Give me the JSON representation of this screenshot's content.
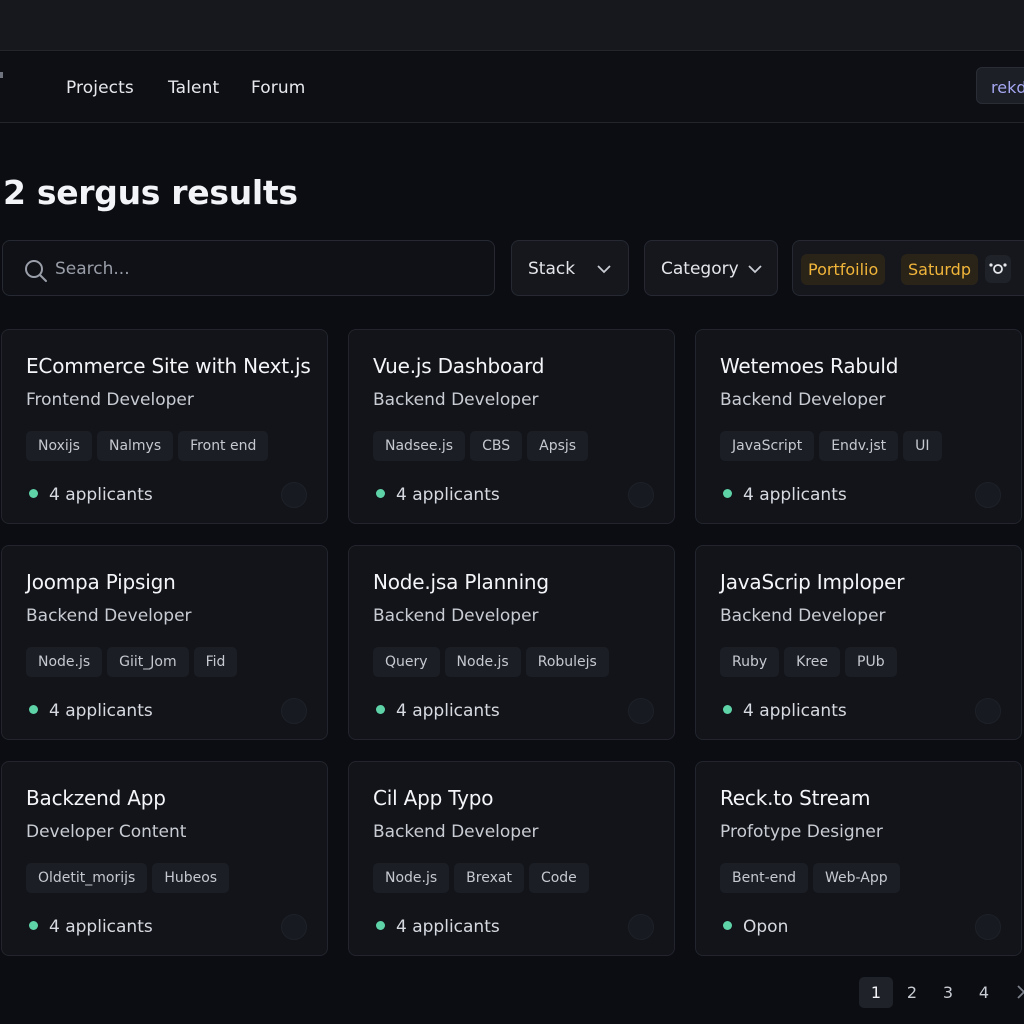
{
  "nav": {
    "links": [
      "Projects",
      "Talent",
      "Forum"
    ],
    "right_button": "rekd"
  },
  "results_title": "2 sergus results",
  "search": {
    "placeholder": "Search..."
  },
  "filters": {
    "stack_label": "Stack",
    "category_label": "Category",
    "active": [
      "Portfoilio",
      "Saturdp"
    ]
  },
  "cards": [
    {
      "title": "ECommerce Site with Next.js",
      "role": "Frontend Developer",
      "tags": [
        "Noxijs",
        "Nalmys",
        "Front end"
      ],
      "status": "4 applicants"
    },
    {
      "title": "Vue.js Dashboard",
      "role": "Backend Developer",
      "tags": [
        "Nadsee.js",
        "CBS",
        "Apsjs"
      ],
      "status": "4 applicants"
    },
    {
      "title": "Wetemoes Rabuld",
      "role": "Backend Developer",
      "tags": [
        "JavaScript",
        "Endv.jst",
        "UI"
      ],
      "status": "4 applicants"
    },
    {
      "title": "Joompa Pipsign",
      "role": "Backend Developer",
      "tags": [
        "Node.js",
        "Giit_Jom",
        "Fid"
      ],
      "status": "4 applicants"
    },
    {
      "title": "Node.jsa Planning",
      "role": "Backend Developer",
      "tags": [
        "Query",
        "Node.js",
        "Robulejs"
      ],
      "status": "4 applicants"
    },
    {
      "title": "JavaScrip Imploper",
      "role": "Backend Developer",
      "tags": [
        "Ruby",
        "Kree",
        "PUb"
      ],
      "status": "4 applicants"
    },
    {
      "title": "Backzend App",
      "role": "Developer Content",
      "tags": [
        "Oldetit_morijs",
        "Hubeos"
      ],
      "status": "4 applicants"
    },
    {
      "title": "Cil App Typo",
      "role": "Backend Developer",
      "tags": [
        "Node.js",
        "Brexat",
        "Code"
      ],
      "status": "4 applicants"
    },
    {
      "title": "Reck.to Stream",
      "role": "Profotype Designer",
      "tags": [
        "Bent-end",
        "Web-App"
      ],
      "status": "Opon"
    }
  ],
  "pagination": {
    "pages": [
      "1",
      "2",
      "3",
      "4"
    ],
    "current": "1"
  },
  "colors": {
    "background": "#0b0d12",
    "card": "#12141a",
    "status_dot": "#5fd3a8",
    "filter_pill_text": "#f1b53a",
    "accent_button_text": "#a5a7f2"
  }
}
